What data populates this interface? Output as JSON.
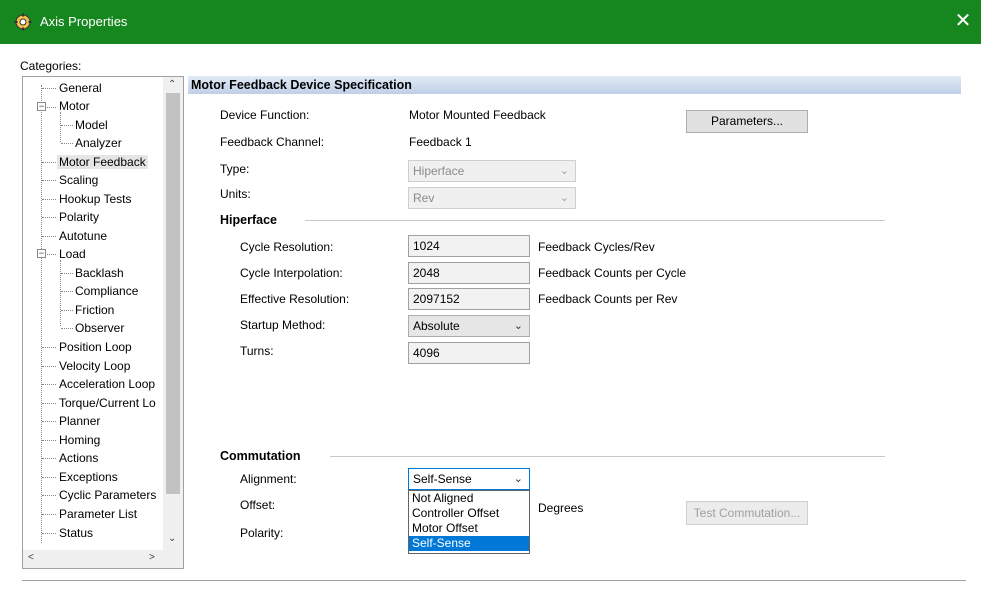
{
  "window": {
    "title": "Axis Properties",
    "close_glyph": "✕",
    "icon": "axis-gear-icon"
  },
  "categories": {
    "label": "Categories:",
    "modified_marker": "*",
    "items": [
      {
        "label": "General"
      },
      {
        "label": "Motor"
      },
      {
        "label": "Model"
      },
      {
        "label": "Analyzer"
      },
      {
        "label": "Motor Feedback"
      },
      {
        "label": "Scaling"
      },
      {
        "label": "Hookup Tests"
      },
      {
        "label": "Polarity"
      },
      {
        "label": "Autotune"
      },
      {
        "label": "Load"
      },
      {
        "label": "Backlash"
      },
      {
        "label": "Compliance"
      },
      {
        "label": "Friction"
      },
      {
        "label": "Observer"
      },
      {
        "label": "Position Loop"
      },
      {
        "label": "Velocity Loop"
      },
      {
        "label": "Acceleration Loop"
      },
      {
        "label": "Torque/Current Lo"
      },
      {
        "label": "Planner"
      },
      {
        "label": "Homing"
      },
      {
        "label": "Actions"
      },
      {
        "label": "Exceptions"
      },
      {
        "label": "Cyclic Parameters"
      },
      {
        "label": "Parameter List"
      },
      {
        "label": "Status"
      }
    ]
  },
  "main": {
    "section_title": "Motor Feedback Device Specification",
    "device_function": {
      "label": "Device Function:",
      "value": "Motor Mounted Feedback"
    },
    "feedback_channel": {
      "label": "Feedback Channel:",
      "value": "Feedback 1"
    },
    "type": {
      "label": "Type:",
      "value": "Hiperface"
    },
    "units": {
      "label": "Units:",
      "value": "Rev"
    },
    "parameters_button": "Parameters...",
    "hiperface": {
      "title": "Hiperface",
      "cycle_resolution": {
        "label": "Cycle Resolution:",
        "value": "1024",
        "unit": "Feedback Cycles/Rev"
      },
      "cycle_interpolation": {
        "label": "Cycle Interpolation:",
        "value": "2048",
        "unit": "Feedback Counts per Cycle"
      },
      "effective_resolution": {
        "label": "Effective Resolution:",
        "value": "2097152",
        "unit": "Feedback Counts per Rev"
      },
      "startup_method": {
        "label": "Startup Method:",
        "value": "Absolute"
      },
      "turns": {
        "label": "Turns:",
        "value": "4096"
      }
    },
    "commutation": {
      "title": "Commutation",
      "alignment": {
        "label": "Alignment:",
        "value": "Self-Sense",
        "options": [
          "Not Aligned",
          "Controller Offset",
          "Motor Offset",
          "Self-Sense"
        ],
        "selected_option": "Self-Sense"
      },
      "offset": {
        "label": "Offset:",
        "unit": "Degrees"
      },
      "polarity": {
        "label": "Polarity:"
      },
      "test_button": "Test Commutation..."
    }
  }
}
